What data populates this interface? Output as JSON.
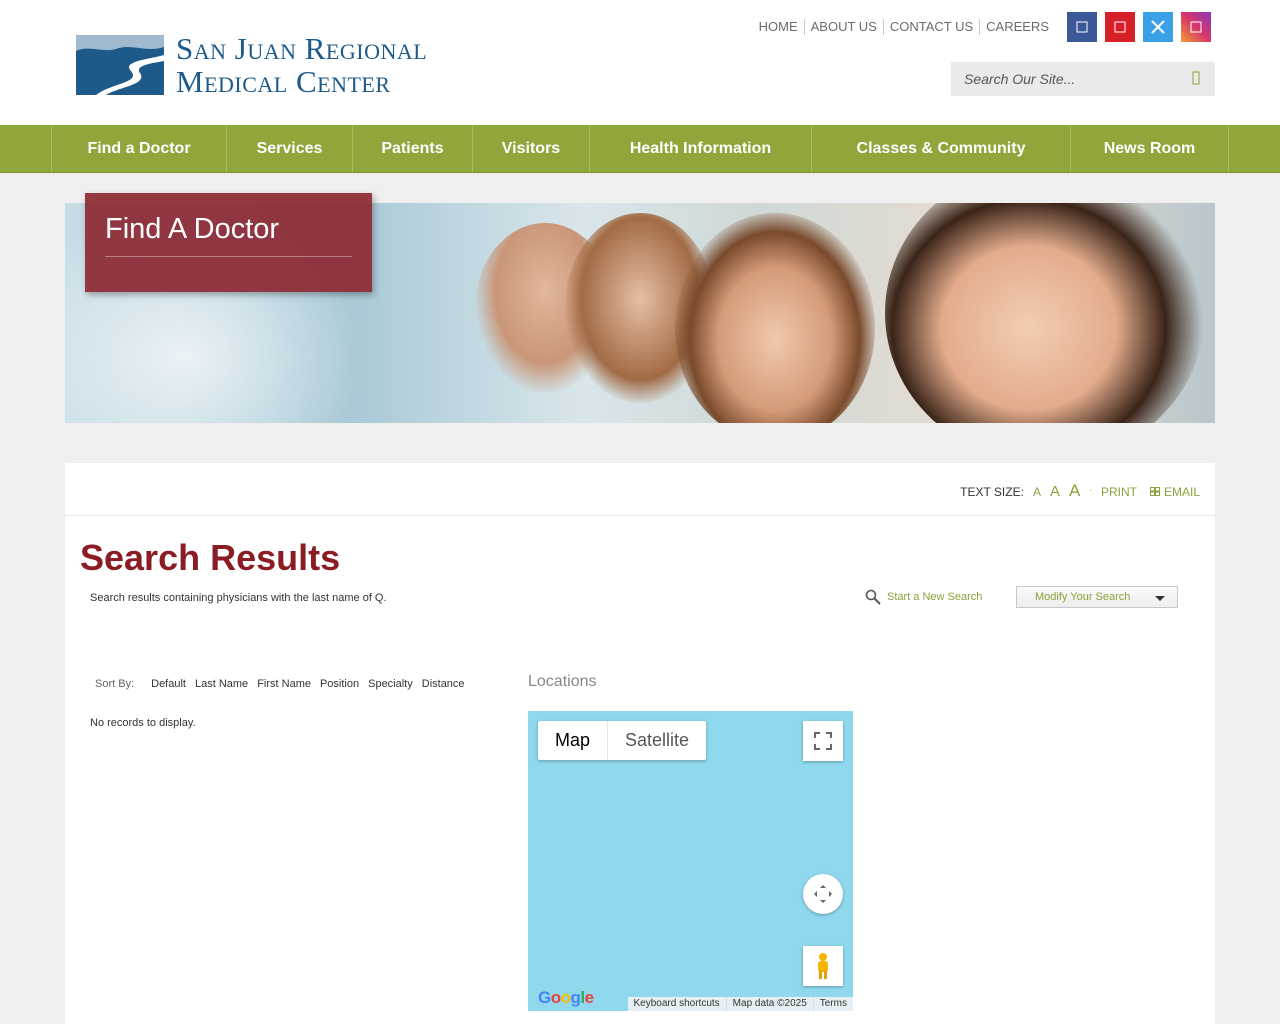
{
  "brand": {
    "name_line1": "San Juan Regional",
    "name_line2": "Medical Center"
  },
  "util_nav": [
    "HOME",
    "ABOUT US",
    "CONTACT US",
    "CAREERS"
  ],
  "social": [
    {
      "name": "facebook",
      "color": "#3b5998"
    },
    {
      "name": "youtube",
      "color": "#d61f26"
    },
    {
      "name": "twitter",
      "color": "#3aa1e8"
    },
    {
      "name": "instagram",
      "color": "#d6366a"
    }
  ],
  "search": {
    "placeholder": "Search Our Site..."
  },
  "main_nav": [
    "Find a Doctor",
    "Services",
    "Patients",
    "Visitors",
    "Health Information",
    "Classes & Community",
    "News Room"
  ],
  "hero": {
    "title": "Find A Doctor"
  },
  "tools": {
    "text_size_label": "TEXT SIZE:",
    "a_small": "A",
    "a_med": "A",
    "a_large": "A",
    "print": "PRINT",
    "email": "EMAIL"
  },
  "results": {
    "title": "Search Results",
    "description": "Search results containing physicians with the last name of Q.",
    "new_search": "Start a New Search",
    "modify": "Modify Your Search",
    "sort_label": "Sort By:",
    "sort_options": [
      "Default",
      "Last Name",
      "First Name",
      "Position",
      "Specialty",
      "Distance"
    ],
    "no_records": "No records to display."
  },
  "locations": {
    "title": "Locations",
    "map_type": [
      "Map",
      "Satellite"
    ],
    "attribution": [
      "Keyboard shortcuts",
      "Map data ©2025",
      "Terms"
    ],
    "google": "Google"
  },
  "colors": {
    "nav_green": "#8fa63a",
    "accent_red": "#8b1c24",
    "link_green": "#8aa33a",
    "map_water": "#8fd8ee"
  }
}
